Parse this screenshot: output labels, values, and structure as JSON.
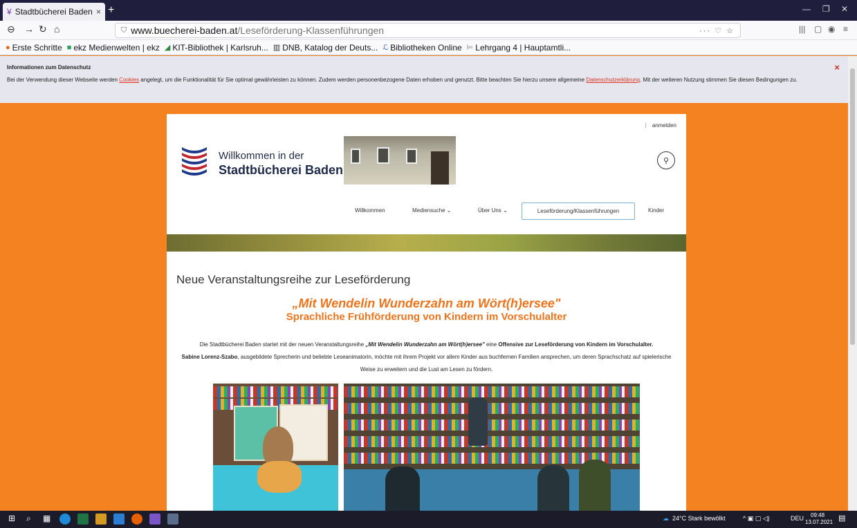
{
  "browser": {
    "tab_title": "Stadtbücherei Baden",
    "tab_close": "×",
    "new_tab": "+",
    "url_domain": "www.buecherei-baden.at",
    "url_path": "/Leseförderung-Klassenführungen",
    "url_icons": "··· ♡ ☆",
    "bookmarks": [
      {
        "label": "Erste Schritte"
      },
      {
        "label": "ekz Medienwelten | ekz"
      },
      {
        "label": "KIT-Bibliothek | Karlsruh..."
      },
      {
        "label": "DNB, Katalog der Deuts..."
      },
      {
        "label": "Bibliotheken Online"
      },
      {
        "label": "Lehrgang 4 | Hauptamtli..."
      }
    ]
  },
  "cookie_banner": {
    "title": "Informationen zum Datenschutz",
    "text_before": "Bei der Verwendung dieser Webseite werden ",
    "link_cookies": "Cookies",
    "text_middle": " angelegt, um die Funktionalität für Sie optimal gewährleisten zu können. Zudem werden personenbezogene Daten erhoben und genutzt. Bitte beachten Sie hierzu unsere allgemeine ",
    "link_privacy": "Datenschutzerklärung",
    "text_after": ". Mit der weiteren Nutzung stimmen Sie diesen Bedingungen zu.",
    "close": "×"
  },
  "site": {
    "login": "anmelden",
    "logo_line1": "Willkommen in der",
    "logo_line2": "Stadtbücherei Baden",
    "nav": [
      {
        "label": "Willkommen"
      },
      {
        "label": "Mediensuche ⌄"
      },
      {
        "label": "Über Uns ⌄"
      },
      {
        "label": "Leseförderung/Klassenführungen"
      },
      {
        "label": "Kinder"
      }
    ]
  },
  "content": {
    "heading": "Neue Veranstaltungsreihe zur Leseförderung",
    "subtitle1": "„Mit Wendelin Wunderzahn am Wört(h)ersee\"",
    "subtitle2": "Sprachliche Frühförderung von Kindern im Vorschulalter",
    "para_1": "Die Stadtbücherei Baden startet mit der neuen Veranstaltungsreihe ",
    "para_2": "„Mit Wendelin Wunderzahn am Wört(h)ersee\"",
    "para_3": " eine ",
    "para_4": "Offensive zur Leseförderung von Kindern im Vorschulalter.",
    "para_5": "Sabine Lorenz-Szabo",
    "para_6": ", ausgebildete Sprecherin und beliebte Leseanimatorin, möchte mit ihrem Projekt vor allem Kinder aus buchfernen Familien ansprechen, um deren Sprachschatz auf spielerische Weise zu erweitern und die Lust am Lesen zu fördern."
  },
  "taskbar": {
    "weather": "24°C Stark bewölkt",
    "lang": "DEU",
    "time": "09:48",
    "date": "13.07.2021"
  },
  "colors": {
    "page_bg": "#f58220",
    "accent_orange": "#f0731a",
    "link_red": "#e2331e",
    "nav_active_border": "#7fb0d8"
  }
}
